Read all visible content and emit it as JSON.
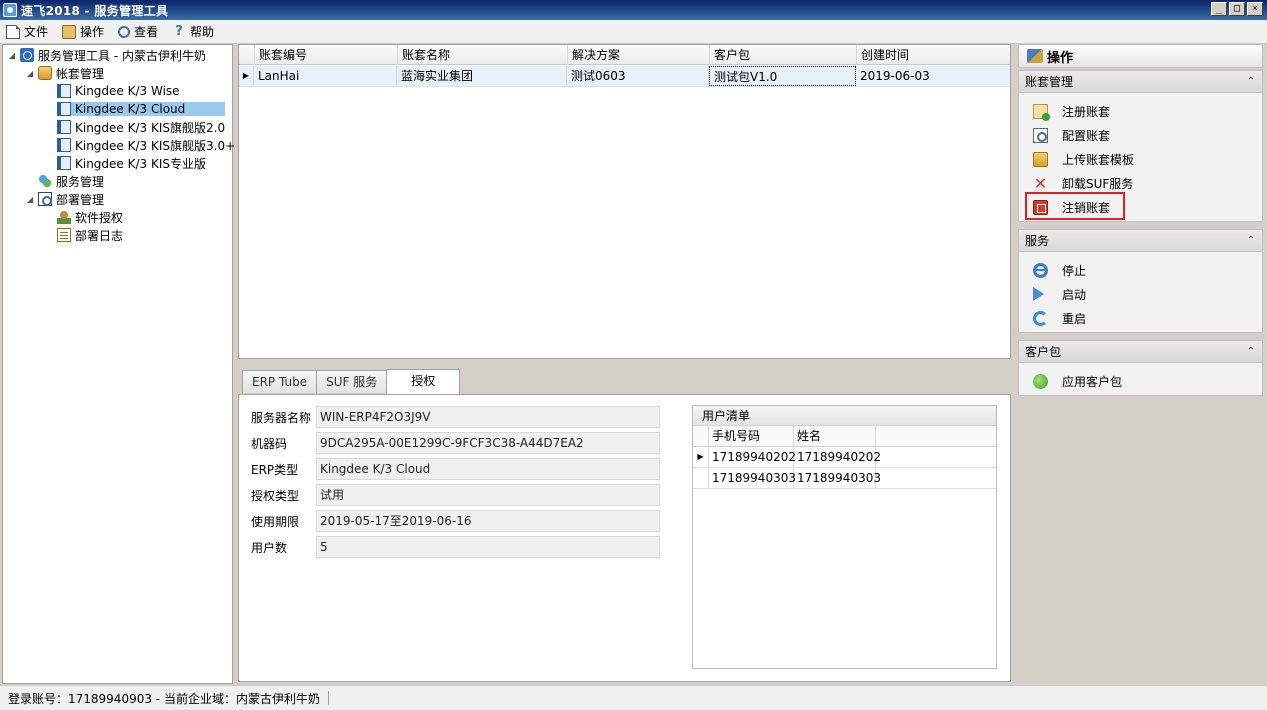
{
  "window": {
    "title": "速飞2018 - 服务管理工具",
    "min_label": "_",
    "max_label": "□",
    "close_label": "×"
  },
  "menu": [
    {
      "label": "文件",
      "icon": "file-icon"
    },
    {
      "label": "操作",
      "icon": "operate-icon"
    },
    {
      "label": "查看",
      "icon": "magnifier-icon"
    },
    {
      "label": "帮助",
      "icon": "help-icon"
    }
  ],
  "tree": {
    "root": "服务管理工具 - 内蒙古伊利牛奶",
    "account_mgmt": "帐套管理",
    "accounts": [
      "Kingdee K/3 Wise",
      "Kingdee K/3 Cloud",
      "Kingdee K/3 KIS旗舰版2.0",
      "Kingdee K/3 KIS旗舰版3.0+",
      "Kingdee K/3 KIS专业版"
    ],
    "service_mgmt": "服务管理",
    "deploy_mgmt": "部署管理",
    "license": "软件授权",
    "deploy_log": "部署日志",
    "expanded_marker": "◢"
  },
  "grid": {
    "columns": [
      "账套编号",
      "账套名称",
      "解决方案",
      "客户包",
      "创建时间"
    ],
    "rows": [
      {
        "indicator": "▶",
        "cells": [
          "LanHai",
          "蓝海实业集团",
          "测试0603",
          "测试包V1.0",
          "2019-06-03"
        ]
      }
    ]
  },
  "tabs": [
    "ERP Tube",
    "SUF 服务",
    "授权"
  ],
  "license_info": [
    {
      "label": "服务器名称",
      "value": "WIN-ERP4F2O3J9V"
    },
    {
      "label": "机器码",
      "value": "9DCA295A-00E1299C-9FCF3C38-A44D7EA2"
    },
    {
      "label": "ERP类型",
      "value": "Kingdee K/3 Cloud"
    },
    {
      "label": "授权类型",
      "value": "试用"
    },
    {
      "label": "使用期限",
      "value": "2019-05-17至2019-06-16"
    },
    {
      "label": "用户数",
      "value": "5"
    }
  ],
  "user_list": {
    "title": "用户清单",
    "columns": [
      "手机号码",
      "姓名"
    ],
    "rows": [
      {
        "indicator": "▶",
        "phone": "17189940202",
        "name": "17189940202"
      },
      {
        "indicator": "",
        "phone": "17189940303",
        "name": "17189940303"
      }
    ]
  },
  "operations": {
    "header": "操作",
    "collapse_glyph": "⌃",
    "groups": [
      {
        "title": "账套管理",
        "items": [
          "注册账套",
          "配置账套",
          "上传账套模板",
          "卸载SUF服务",
          "注销账套"
        ]
      },
      {
        "title": "服务",
        "items": [
          "停止",
          "启动",
          "重启"
        ]
      },
      {
        "title": "客户包",
        "items": [
          "应用客户包"
        ]
      }
    ],
    "highlight_color": "#e02020"
  },
  "status": {
    "text": "登录账号：17189940903 - 当前企业域：内蒙古伊利牛奶"
  },
  "colors": {
    "title_bar": "#0a246a",
    "selection": "#99c9ef",
    "grid_selected_row": "#e8f0fa"
  }
}
